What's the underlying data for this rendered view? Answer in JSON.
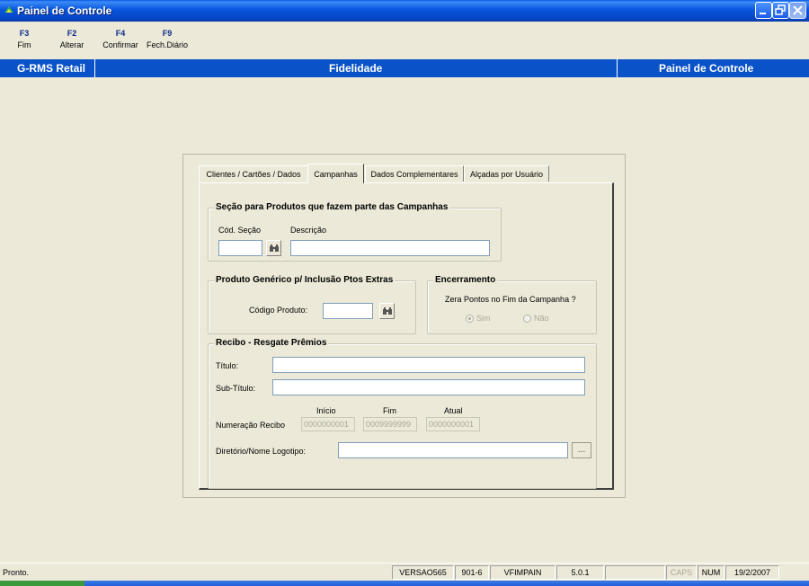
{
  "window": {
    "title": "Painel de Controle",
    "app_icon": "grms-app-icon",
    "controls": [
      "minimize-icon",
      "restore-icon",
      "close-icon"
    ]
  },
  "fkeys": [
    {
      "key": "F3",
      "label": "Fim"
    },
    {
      "key": "F2",
      "label": "Alterar"
    },
    {
      "key": "F4",
      "label": "Confirmar"
    },
    {
      "key": "F9",
      "label": "Fech.Diário"
    }
  ],
  "header": {
    "left": "G-RMS Retail",
    "center": "Fidelidade",
    "right": "Painel de Controle",
    "color": "#0a52c8"
  },
  "tabs": [
    {
      "label": "Clientes / Cartões / Dados",
      "active": false
    },
    {
      "label": "Campanhas",
      "active": true
    },
    {
      "label": "Dados Complementares",
      "active": false
    },
    {
      "label": "Alçadas por Usuário",
      "active": false
    }
  ],
  "secao": {
    "title": "Seção para Produtos que fazem parte das Campanhas",
    "cod_label": "Cód. Seção",
    "cod_value": "",
    "desc_label": "Descrição",
    "desc_value": ""
  },
  "produto": {
    "title": "Produto Genérico p/ Inclusão Ptos Extras",
    "codigo_label": "Código Produto:",
    "codigo_value": ""
  },
  "encerramento": {
    "title": "Encerramento",
    "question": "Zera Pontos no Fim da Campanha ?",
    "option_yes": "Sim",
    "option_no": "Não",
    "selected": "Sim"
  },
  "recibo": {
    "title": "Recibo - Resgate Prêmios",
    "titulo_label": "Título:",
    "titulo_value": "",
    "subtitulo_label": "Sub-Título:",
    "subtitulo_value": "",
    "numeracao_label": "Numeração Recibo",
    "inicio_label": "Início",
    "inicio_value": "0000000001",
    "fim_label": "Fim",
    "fim_value": "0009999999",
    "atual_label": "Atual",
    "atual_value": "0000000001",
    "logo_label": "Diretório/Nome Logotipo:",
    "logo_value": "",
    "browse_label": "..."
  },
  "status": {
    "message": "Pronto.",
    "version": "VERSAO565",
    "code": "901-6",
    "module": "VFIMPAIN",
    "release": "5.0.1",
    "blank": "",
    "caps": "CAPS",
    "num": "NUM",
    "date": "19/2/2007"
  }
}
